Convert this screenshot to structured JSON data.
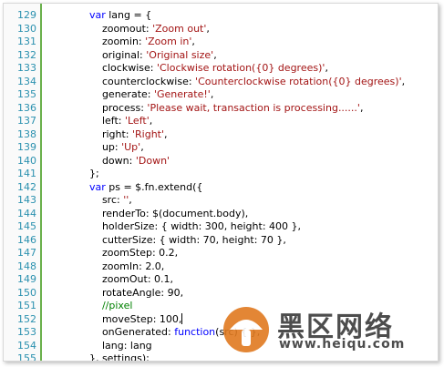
{
  "lines": [
    {
      "n": "129",
      "parts": [
        {
          "t": "            "
        },
        {
          "t": "var",
          "c": "kw"
        },
        {
          "t": " lang = {"
        }
      ]
    },
    {
      "n": "130",
      "parts": [
        {
          "t": "                zoomout: "
        },
        {
          "t": "'Zoom out'",
          "c": "str"
        },
        {
          "t": ","
        }
      ]
    },
    {
      "n": "131",
      "parts": [
        {
          "t": "                zoomin: "
        },
        {
          "t": "'Zoom in'",
          "c": "str"
        },
        {
          "t": ","
        }
      ]
    },
    {
      "n": "132",
      "parts": [
        {
          "t": "                original: "
        },
        {
          "t": "'Original size'",
          "c": "str"
        },
        {
          "t": ","
        }
      ]
    },
    {
      "n": "133",
      "parts": [
        {
          "t": "                clockwise: "
        },
        {
          "t": "'Clockwise rotation({0} degrees)'",
          "c": "str"
        },
        {
          "t": ","
        }
      ]
    },
    {
      "n": "134",
      "parts": [
        {
          "t": "                counterclockwise: "
        },
        {
          "t": "'Counterclockwise rotation({0} degrees)'",
          "c": "str"
        },
        {
          "t": ","
        }
      ]
    },
    {
      "n": "135",
      "parts": [
        {
          "t": "                generate: "
        },
        {
          "t": "'Generate!'",
          "c": "str"
        },
        {
          "t": ","
        }
      ]
    },
    {
      "n": "136",
      "parts": [
        {
          "t": "                process: "
        },
        {
          "t": "'Please wait, transaction is processing......'",
          "c": "str"
        },
        {
          "t": ","
        }
      ]
    },
    {
      "n": "137",
      "parts": [
        {
          "t": "                left: "
        },
        {
          "t": "'Left'",
          "c": "str"
        },
        {
          "t": ","
        }
      ]
    },
    {
      "n": "138",
      "parts": [
        {
          "t": "                right: "
        },
        {
          "t": "'Right'",
          "c": "str"
        },
        {
          "t": ","
        }
      ]
    },
    {
      "n": "139",
      "parts": [
        {
          "t": "                up: "
        },
        {
          "t": "'Up'",
          "c": "str"
        },
        {
          "t": ","
        }
      ]
    },
    {
      "n": "140",
      "parts": [
        {
          "t": "                down: "
        },
        {
          "t": "'Down'",
          "c": "str"
        }
      ]
    },
    {
      "n": "141",
      "parts": [
        {
          "t": "            };"
        }
      ]
    },
    {
      "n": "142",
      "parts": [
        {
          "t": "            "
        },
        {
          "t": "var",
          "c": "kw"
        },
        {
          "t": " ps = $.fn.extend({"
        }
      ]
    },
    {
      "n": "143",
      "parts": [
        {
          "t": "                src: "
        },
        {
          "t": "''",
          "c": "str"
        },
        {
          "t": ","
        }
      ]
    },
    {
      "n": "144",
      "parts": [
        {
          "t": "                renderTo: $(document.body),"
        }
      ]
    },
    {
      "n": "145",
      "parts": [
        {
          "t": "                holderSize: { width: 300, height: 400 },"
        }
      ]
    },
    {
      "n": "146",
      "parts": [
        {
          "t": "                cutterSize: { width: 70, height: 70 },"
        }
      ]
    },
    {
      "n": "147",
      "parts": [
        {
          "t": "                zoomStep: 0.2,"
        }
      ]
    },
    {
      "n": "148",
      "parts": [
        {
          "t": "                zoomIn: 2.0,"
        }
      ]
    },
    {
      "n": "149",
      "parts": [
        {
          "t": "                zoomOut: 0.1,"
        }
      ]
    },
    {
      "n": "150",
      "parts": [
        {
          "t": "                rotateAngle: 90,"
        }
      ]
    },
    {
      "n": "151",
      "parts": [
        {
          "t": "                "
        },
        {
          "t": "//pixel",
          "c": "cm"
        }
      ]
    },
    {
      "n": "152",
      "parts": [
        {
          "t": "                moveStep: 100,"
        }
      ],
      "cursor": true
    },
    {
      "n": "153",
      "parts": [
        {
          "t": "                onGenerated: "
        },
        {
          "t": "function",
          "c": "kw"
        },
        {
          "t": "(src) { },"
        }
      ]
    },
    {
      "n": "154",
      "parts": [
        {
          "t": "                lang: lang"
        }
      ]
    },
    {
      "n": "155",
      "parts": [
        {
          "t": "            }, settings);"
        }
      ]
    }
  ],
  "watermark": {
    "brand": "黑区网络",
    "url": "www.heiqu.com"
  },
  "colors": {
    "keyword": "#0000ff",
    "string": "#a31515",
    "comment": "#008000",
    "line_number": "#2b91af",
    "gutter_border": "#6ab04c"
  }
}
